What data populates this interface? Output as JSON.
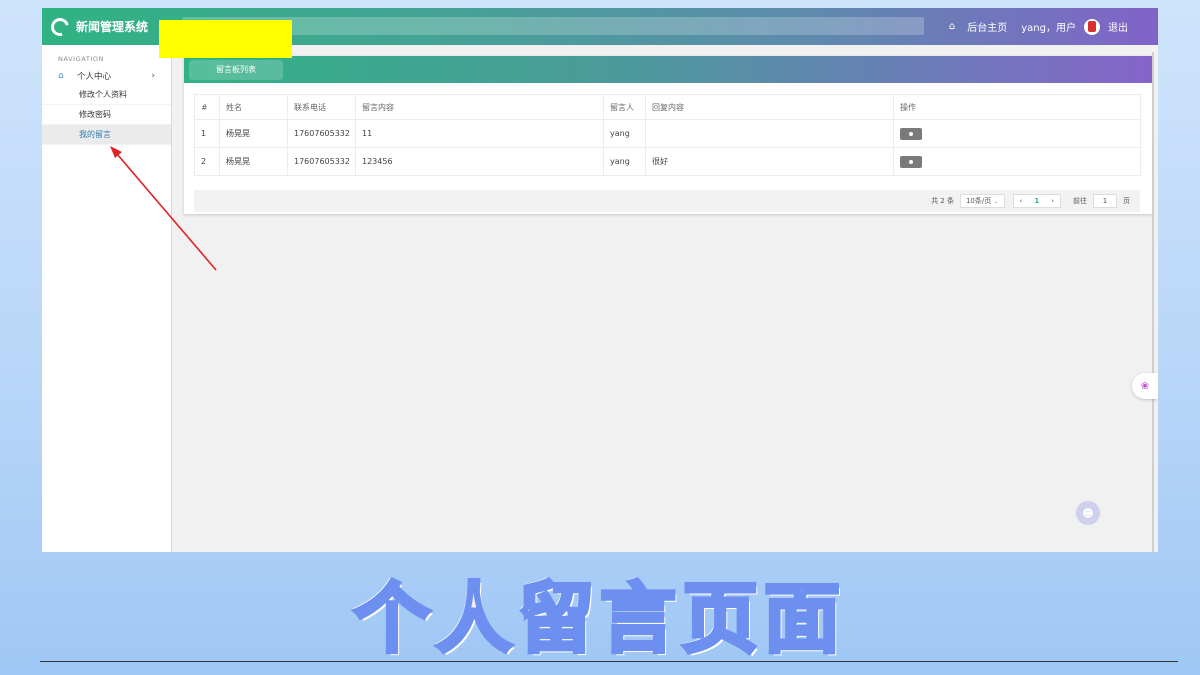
{
  "app": {
    "title": "新闻管理系统"
  },
  "topbar": {
    "home_label": "后台主页",
    "user_label": "yang，用户",
    "logout_label": "退出"
  },
  "sidebar": {
    "heading": "NAVIGATION",
    "parent_label": "个人中心",
    "items": [
      {
        "label": "修改个人资料"
      },
      {
        "label": "修改密码"
      },
      {
        "label": "我的留言"
      }
    ]
  },
  "card": {
    "tab_label": "留言板列表"
  },
  "table": {
    "headers": [
      "#",
      "姓名",
      "联系电话",
      "留言内容",
      "留言人",
      "回复内容",
      "操作"
    ],
    "rows": [
      {
        "idx": "1",
        "name": "杨晃晃",
        "phone": "17607605332",
        "content": "11",
        "author": "yang",
        "reply": ""
      },
      {
        "idx": "2",
        "name": "杨晃晃",
        "phone": "17607605332",
        "content": "123456",
        "author": "yang",
        "reply": "很好"
      }
    ]
  },
  "pager": {
    "total": "共 2 条",
    "page_size": "10条/页",
    "prev": "‹",
    "current": "1",
    "next": "›",
    "goto_prefix": "前往",
    "goto_value": "1",
    "goto_suffix": "页"
  },
  "caption": "个人留言页面",
  "colors": {
    "accent": "#2fb383",
    "annotation": "#e02424"
  }
}
